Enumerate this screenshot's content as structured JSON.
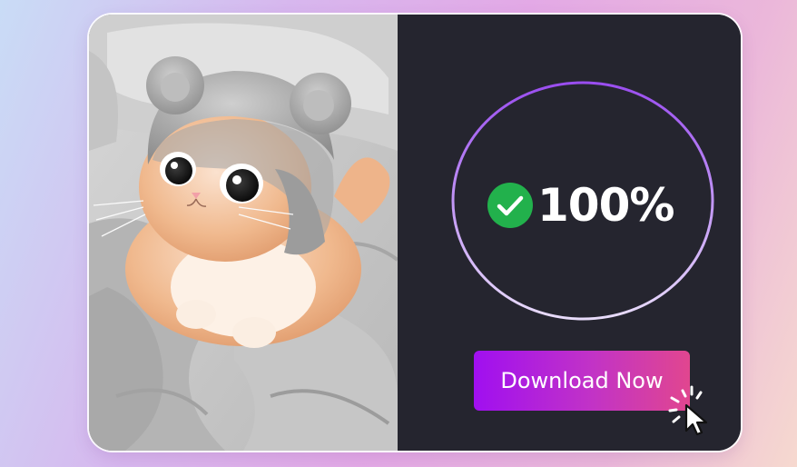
{
  "progress": {
    "value": 100,
    "label": "100%",
    "status": "complete",
    "check_color": "#22b14c"
  },
  "action": {
    "download_label": "Download Now"
  },
  "colors": {
    "panel_bg": "#25252f",
    "ring_start": "#9a4df0",
    "ring_end": "#e8dcfb",
    "button_start": "#a00ff0",
    "button_end": "#e1468f"
  },
  "icons": {
    "status": "check-circle-icon",
    "cursor": "pointer-click-icon"
  },
  "image": {
    "subject": "cat-in-bear-ear-hat-photo"
  }
}
